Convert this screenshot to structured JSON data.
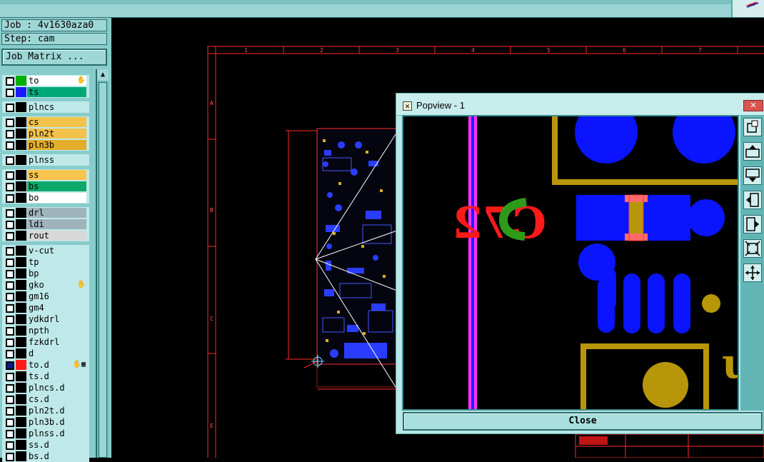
{
  "info": {
    "job_label": "Job : 4v1630aza0",
    "step_label": "Step: cam",
    "job_matrix_button": "Job Matrix ..."
  },
  "layers": [
    {
      "name": "to",
      "swatch": "#00b000",
      "fill": "#ffffff",
      "checked": false,
      "mark": "hand"
    },
    {
      "name": "ts",
      "swatch": "#1a1aff",
      "fill": "#00a878",
      "checked": false,
      "mark": ""
    },
    {
      "name": "plncs",
      "swatch": "#000000",
      "fill": "#bfe9e9",
      "checked": false,
      "mark": ""
    },
    {
      "name": "cs",
      "swatch": "#000000",
      "fill": "#f2c24a",
      "checked": false,
      "mark": ""
    },
    {
      "name": "pln2t",
      "swatch": "#000000",
      "fill": "#f2c24a",
      "checked": false,
      "mark": ""
    },
    {
      "name": "pln3b",
      "swatch": "#000000",
      "fill": "#e3ad2a",
      "checked": false,
      "mark": ""
    },
    {
      "name": "plnss",
      "swatch": "#000000",
      "fill": "#bfe9e9",
      "checked": false,
      "mark": ""
    },
    {
      "name": "ss",
      "swatch": "#000000",
      "fill": "#f7c44e",
      "checked": false,
      "mark": ""
    },
    {
      "name": "bs",
      "swatch": "#000000",
      "fill": "#0ea86b",
      "checked": false,
      "mark": ""
    },
    {
      "name": "bo",
      "swatch": "#000000",
      "fill": "#ffffff",
      "checked": false,
      "mark": ""
    },
    {
      "name": "drl",
      "swatch": "#000000",
      "fill": "#9fb3bb",
      "checked": false,
      "mark": ""
    },
    {
      "name": "ldi",
      "swatch": "#000000",
      "fill": "#9fb3bb",
      "checked": false,
      "mark": ""
    },
    {
      "name": "rout",
      "swatch": "#000000",
      "fill": "#d8d8d8",
      "checked": false,
      "mark": ""
    },
    {
      "name": "v-cut",
      "swatch": "#000000",
      "fill": "#bfe9e9",
      "checked": false,
      "mark": ""
    },
    {
      "name": "tp",
      "swatch": "#000000",
      "fill": "#bfe9e9",
      "checked": false,
      "mark": ""
    },
    {
      "name": "bp",
      "swatch": "#000000",
      "fill": "#bfe9e9",
      "checked": false,
      "mark": ""
    },
    {
      "name": "gko",
      "swatch": "#000000",
      "fill": "#bfe9e9",
      "checked": false,
      "mark": "hand"
    },
    {
      "name": "gm16",
      "swatch": "#000000",
      "fill": "#bfe9e9",
      "checked": false,
      "mark": ""
    },
    {
      "name": "gm4",
      "swatch": "#000000",
      "fill": "#bfe9e9",
      "checked": false,
      "mark": ""
    },
    {
      "name": "ydkdrl",
      "swatch": "#000000",
      "fill": "#bfe9e9",
      "checked": false,
      "mark": ""
    },
    {
      "name": "npth",
      "swatch": "#000000",
      "fill": "#bfe9e9",
      "checked": false,
      "mark": ""
    },
    {
      "name": "fzkdrl",
      "swatch": "#000000",
      "fill": "#bfe9e9",
      "checked": false,
      "mark": ""
    },
    {
      "name": "d",
      "swatch": "#000000",
      "fill": "#bfe9e9",
      "checked": false,
      "mark": ""
    },
    {
      "name": "to.d",
      "swatch": "#ff1a1a",
      "fill": "#bfe9e9",
      "checked": true,
      "mark": "hand-grid"
    },
    {
      "name": "ts.d",
      "swatch": "#000000",
      "fill": "#bfe9e9",
      "checked": false,
      "mark": ""
    },
    {
      "name": "plncs.d",
      "swatch": "#000000",
      "fill": "#bfe9e9",
      "checked": false,
      "mark": ""
    },
    {
      "name": "cs.d",
      "swatch": "#000000",
      "fill": "#bfe9e9",
      "checked": false,
      "mark": ""
    },
    {
      "name": "pln2t.d",
      "swatch": "#000000",
      "fill": "#bfe9e9",
      "checked": false,
      "mark": ""
    },
    {
      "name": "pln3b.d",
      "swatch": "#000000",
      "fill": "#bfe9e9",
      "checked": false,
      "mark": ""
    },
    {
      "name": "plnss.d",
      "swatch": "#000000",
      "fill": "#bfe9e9",
      "checked": false,
      "mark": ""
    },
    {
      "name": "ss.d",
      "swatch": "#000000",
      "fill": "#bfe9e9",
      "checked": false,
      "mark": ""
    },
    {
      "name": "bs.d",
      "swatch": "#000000",
      "fill": "#bfe9e9",
      "checked": false,
      "mark": ""
    }
  ],
  "canvas": {
    "column_labels": [
      "1",
      "2",
      "3",
      "4",
      "5",
      "6",
      "7"
    ],
    "row_labels": [
      "A",
      "B",
      "C",
      "D",
      "E"
    ]
  },
  "popview": {
    "title": "Popview - 1",
    "close_label": "Close",
    "silk_text": "C72",
    "silk_text_right": "u"
  },
  "colors": {
    "panel": "#88cccc",
    "frame": "#ff2a2a",
    "copper": "#0a14ff",
    "pad_gold": "#b8960a",
    "magenta": "#ff33ff"
  }
}
